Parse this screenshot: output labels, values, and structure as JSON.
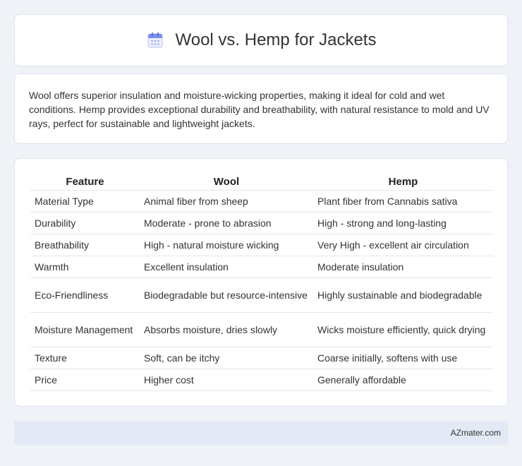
{
  "header": {
    "title": "Wool vs. Hemp for Jackets",
    "icon": "calendar-icon"
  },
  "intro": {
    "text": "Wool offers superior insulation and moisture-wicking properties, making it ideal for cold and wet conditions. Hemp provides exceptional durability and breathability, with natural resistance to mold and UV rays, perfect for sustainable and lightweight jackets."
  },
  "table": {
    "headers": [
      "Feature",
      "Wool",
      "Hemp"
    ],
    "rows": [
      [
        "Material Type",
        "Animal fiber from sheep",
        "Plant fiber from Cannabis sativa"
      ],
      [
        "Durability",
        "Moderate - prone to abrasion",
        "High - strong and long-lasting"
      ],
      [
        "Breathability",
        "High - natural moisture wicking",
        "Very High - excellent air circulation"
      ],
      [
        "Warmth",
        "Excellent insulation",
        "Moderate insulation"
      ],
      [
        "Eco-Friendliness",
        "Biodegradable but resource-intensive",
        "Highly sustainable and biodegradable"
      ],
      [
        "Moisture Management",
        "Absorbs moisture, dries slowly",
        "Wicks moisture efficiently, quick drying"
      ],
      [
        "Texture",
        "Soft, can be itchy",
        "Coarse initially, softens with use"
      ],
      [
        "Price",
        "Higher cost",
        "Generally affordable"
      ]
    ]
  },
  "footer": {
    "text": "AZmater.com"
  },
  "colors": {
    "page_background": "#eff2f7",
    "card_background": "#ffffff",
    "footer_background": "#e3e9f5",
    "icon_accent": "#7b8cf0"
  }
}
